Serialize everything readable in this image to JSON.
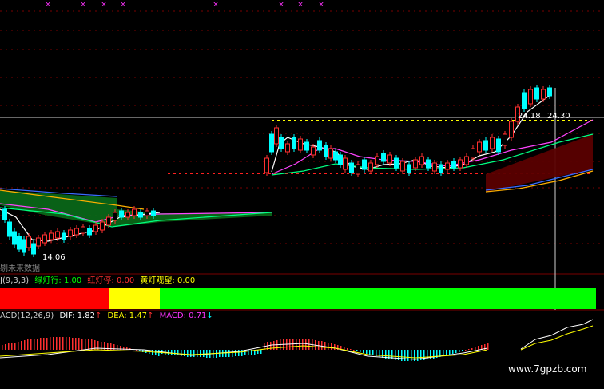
{
  "price_panel": {
    "low_label": "14.06",
    "high_label_left": "24.18",
    "high_label_right": "24.30",
    "future_label": "未来数据",
    "future_label_prefix": "剔"
  },
  "kdj_panel": {
    "indicator": "J(9,3,3)",
    "green_label": "绿灯行: 1.00",
    "red_label": "红灯停: 0.00",
    "yellow_label": "黄灯观望: 0.00",
    "colors": {
      "green": "#00ff00",
      "red": "#ff0000",
      "yellow": "#ffff00"
    }
  },
  "macd_panel": {
    "indicator": "ACD(12,26,9)",
    "dif_label": "DIF: 1.82",
    "dif_arrow": "↑",
    "dea_label": "DEA: 1.47",
    "dea_arrow": "↑",
    "macd_label": "MACD: 0.71",
    "macd_arrow": "↓"
  },
  "watermark": "www.7gpzb.com"
}
